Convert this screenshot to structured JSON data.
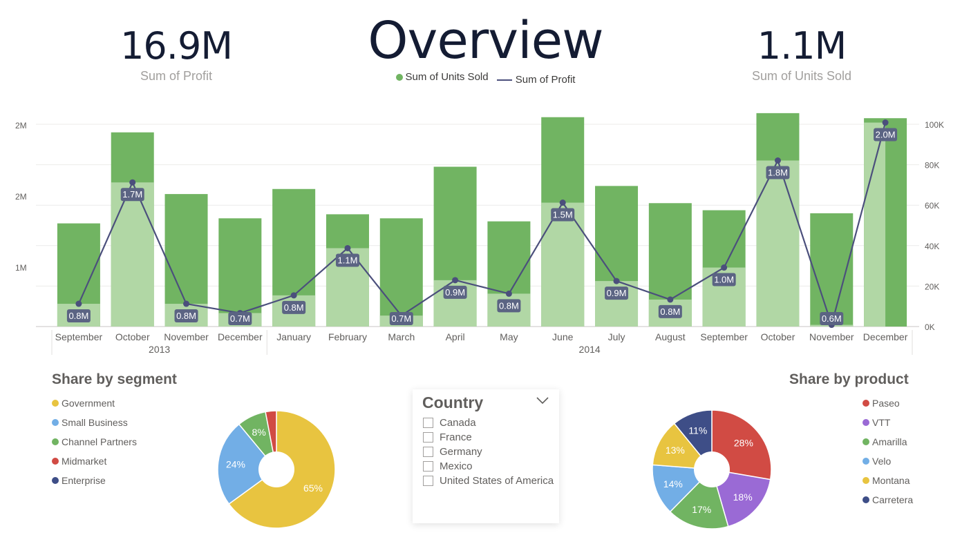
{
  "title": "Overview",
  "kpis": {
    "profit": {
      "value": "16.9M",
      "label": "Sum of Profit"
    },
    "units": {
      "value": "1.1M",
      "label": "Sum of Units Sold"
    }
  },
  "colors": {
    "bar": "#71b462",
    "bar_light": "#b1d7a5",
    "line": "#4b4f7c",
    "label_bg": "#5b6483",
    "text": "#252423",
    "axis": "#605e5c"
  },
  "chart_data": [
    {
      "type": "bar+line",
      "legend": [
        "Sum of Units Sold",
        "Sum of Profit"
      ],
      "legend_position": "top-center",
      "grid": true,
      "categories": [
        "September",
        "October",
        "November",
        "December",
        "January",
        "February",
        "March",
        "April",
        "May",
        "June",
        "July",
        "August",
        "September",
        "October",
        "November",
        "December"
      ],
      "year_groups": [
        {
          "label": "2013",
          "count": 4
        },
        {
          "label": "2014",
          "count": 12
        }
      ],
      "left_ticks": [
        "2M",
        "2M",
        "1M"
      ],
      "right_ticks": [
        "100K",
        "80K",
        "60K",
        "40K",
        "20K",
        "0K"
      ],
      "y_units_sold_lim": [
        0,
        100000
      ],
      "series": [
        {
          "name": "Sum of Units Sold",
          "axis": "right",
          "kind": "bar",
          "values": [
            51000,
            96000,
            65500,
            53500,
            68000,
            55500,
            53500,
            79000,
            52000,
            103500,
            69500,
            61000,
            57500,
            105500,
            56000,
            103000
          ]
        },
        {
          "name": "Sum of Profit",
          "axis": "left",
          "kind": "line",
          "values": [
            0.27,
            1.71,
            0.27,
            0.16,
            0.37,
            0.93,
            0.13,
            0.55,
            0.39,
            1.47,
            0.54,
            0.32,
            0.7,
            1.97,
            0.02,
            2.42
          ],
          "labels": [
            "0.8M",
            "1.7M",
            "0.8M",
            "0.7M",
            "0.8M",
            "1.1M",
            "0.7M",
            "0.9M",
            "0.8M",
            "1.5M",
            "0.9M",
            "0.8M",
            "1.0M",
            "1.8M",
            "0.6M",
            "2.0M"
          ]
        }
      ]
    },
    {
      "type": "pie",
      "title": "Share by segment",
      "legend_position": "left",
      "categories": [
        "Government",
        "Small Business",
        "Channel Partners",
        "Midmarket",
        "Enterprise"
      ],
      "values": [
        65,
        24,
        8,
        3,
        0
      ],
      "labels": [
        "65%",
        "24%",
        "8%",
        "",
        ""
      ],
      "colors": [
        "#e8c440",
        "#72aee6",
        "#71b462",
        "#d14b44",
        "#3e4e87"
      ]
    },
    {
      "type": "pie",
      "title": "Share by product",
      "legend_position": "right",
      "categories": [
        "Paseo",
        "VTT",
        "Amarilla",
        "Velo",
        "Montana",
        "Carretera"
      ],
      "values": [
        28,
        18,
        17,
        14,
        13,
        11
      ],
      "labels": [
        "28%",
        "18%",
        "17%",
        "14%",
        "13%",
        "11%"
      ],
      "colors": [
        "#d14b44",
        "#9a6ad5",
        "#71b462",
        "#72aee6",
        "#e8c440",
        "#3e4e87"
      ]
    }
  ],
  "slicer": {
    "title": "Country",
    "options": [
      "Canada",
      "France",
      "Germany",
      "Mexico",
      "United States of America"
    ]
  }
}
